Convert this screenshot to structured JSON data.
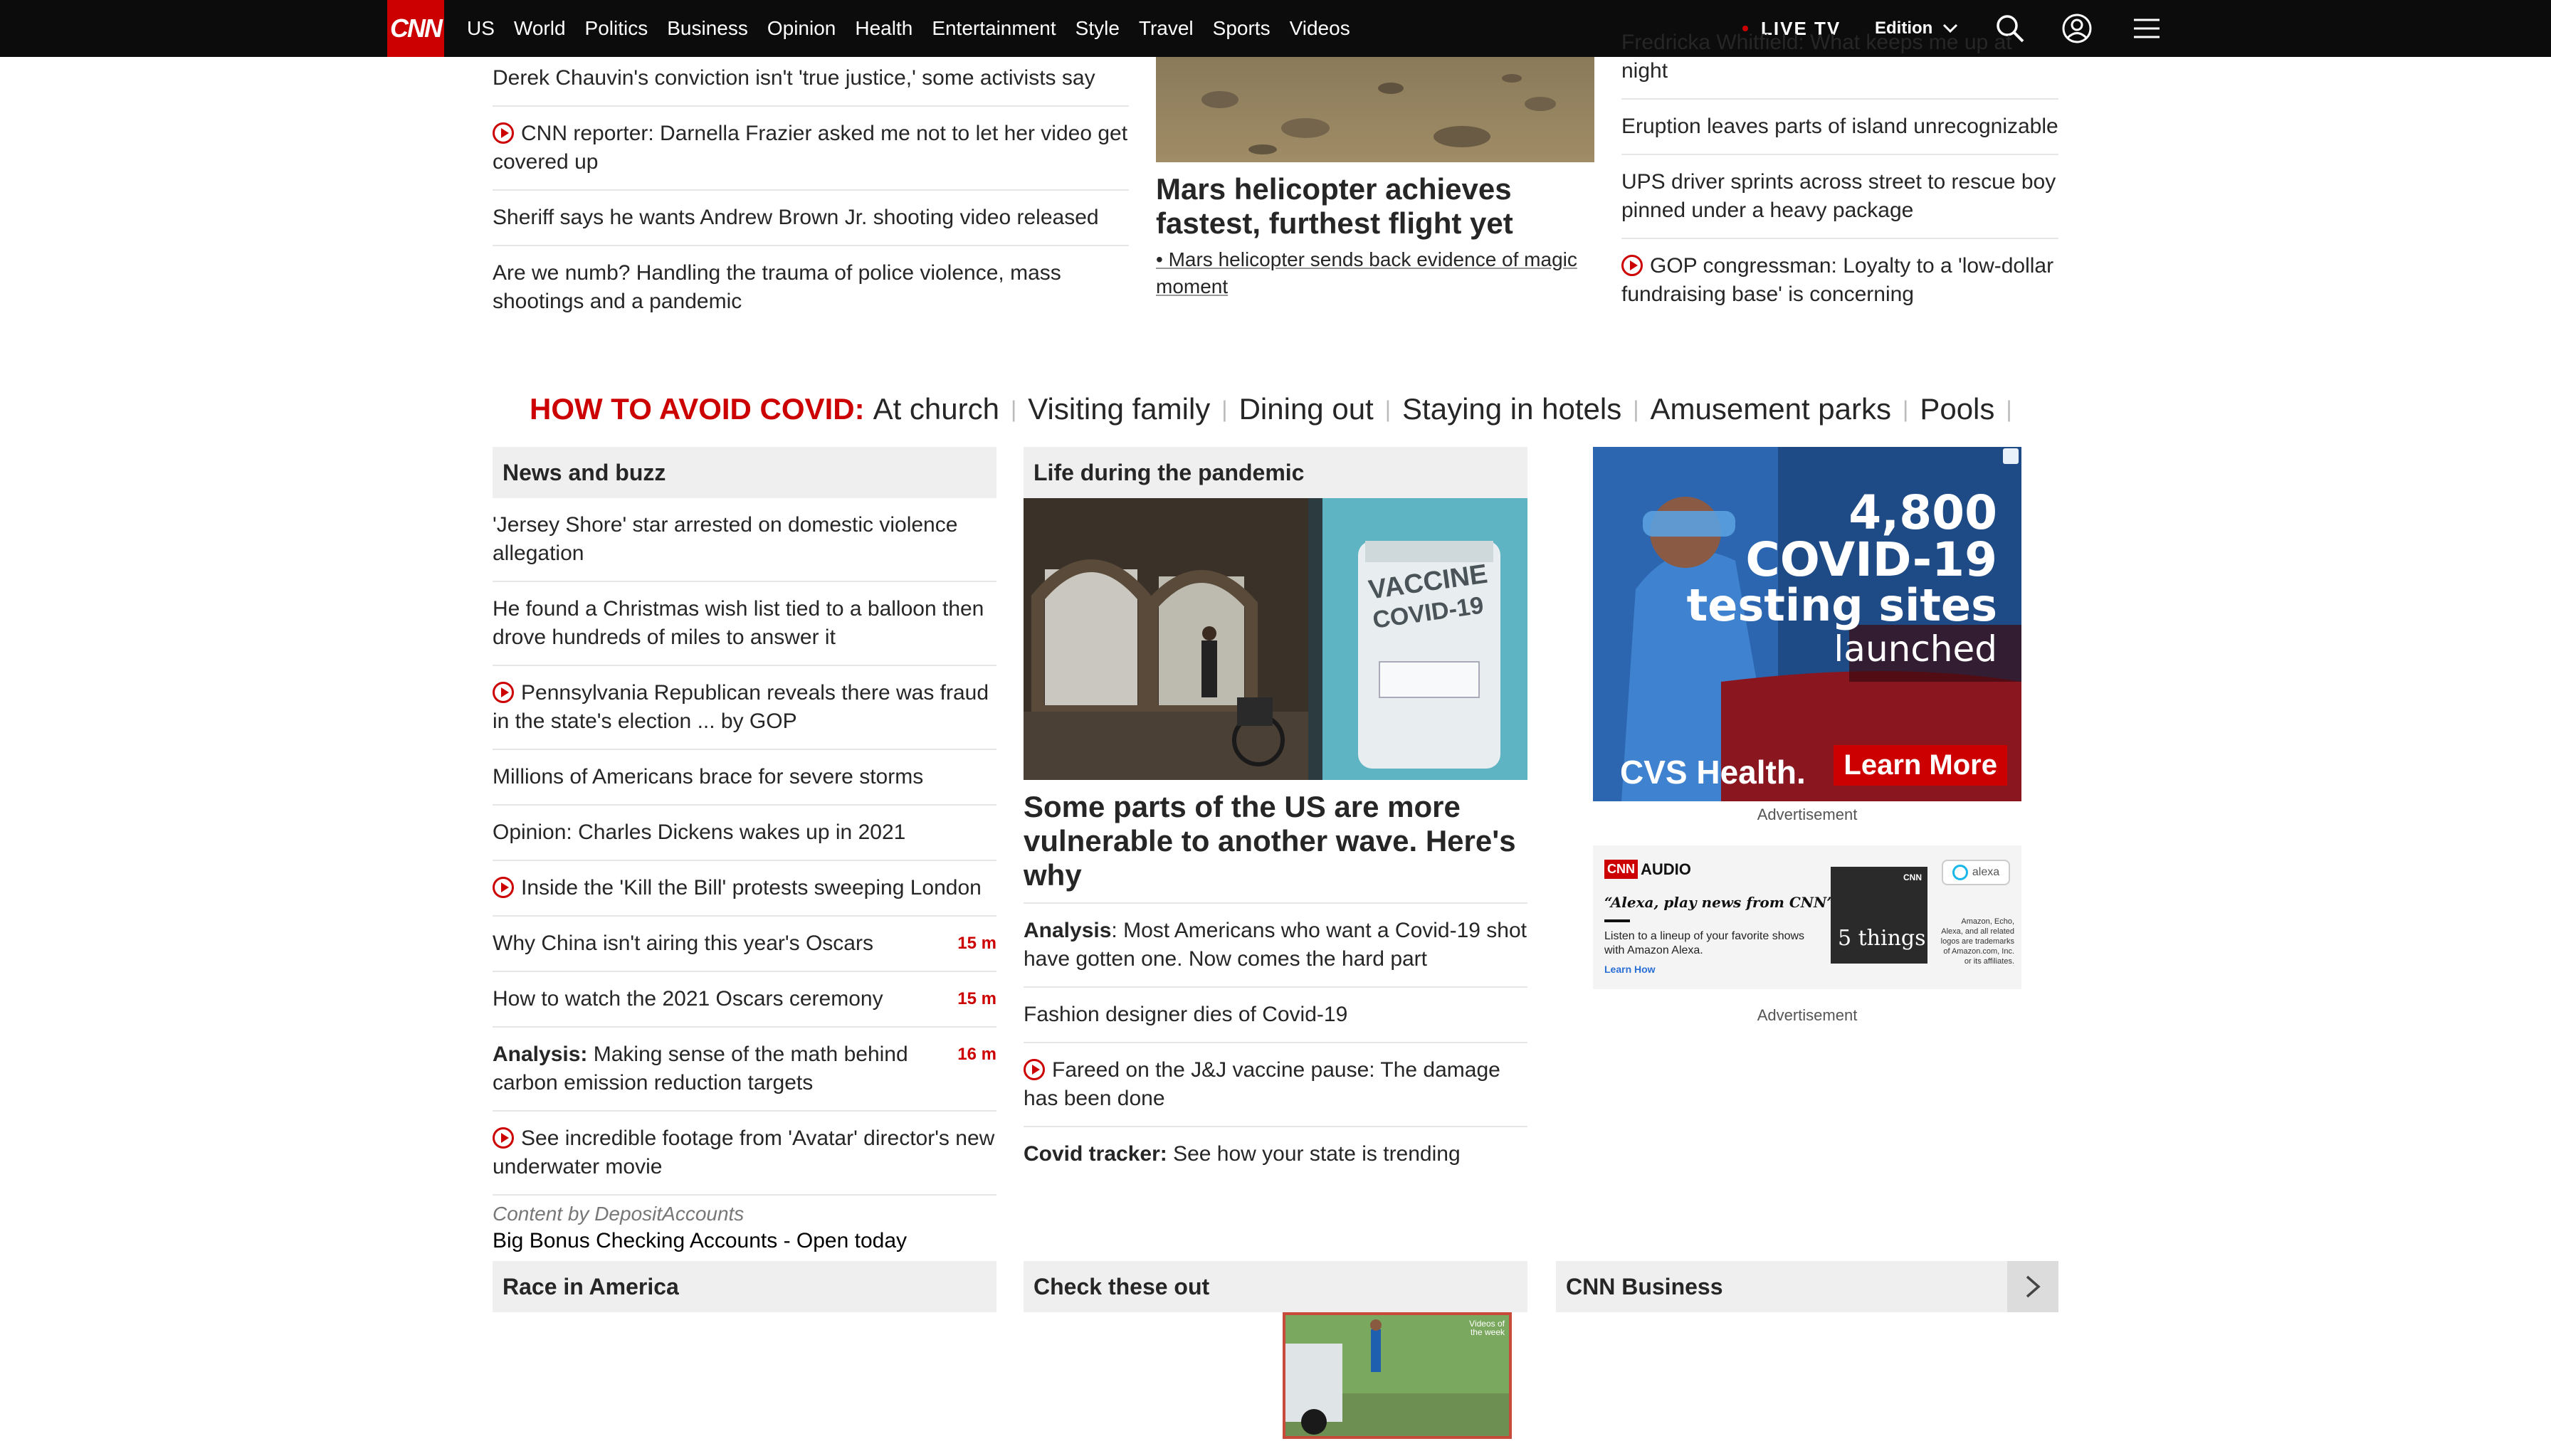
{
  "nav": {
    "logo": "CNN",
    "links": [
      "US",
      "World",
      "Politics",
      "Business",
      "Opinion",
      "Health",
      "Entertainment",
      "Style",
      "Travel",
      "Sports",
      "Videos"
    ],
    "live_tv": "LIVE TV",
    "edition": "Edition"
  },
  "top": {
    "left_items": [
      {
        "text": "Derek Chauvin's conviction isn't 'true justice,' some activists say",
        "video": false
      },
      {
        "text": "CNN reporter: Darnella Frazier asked me not to let her video get covered up",
        "video": true
      },
      {
        "text": "Sheriff says he wants Andrew Brown Jr. shooting video released",
        "video": false
      },
      {
        "text": "Are we numb? Handling the trauma of police violence, mass shootings and a pandemic",
        "video": false
      }
    ],
    "center": {
      "headline": "Mars helicopter achieves fastest, furthest flight yet",
      "sub": "• Mars helicopter sends back evidence of magic moment"
    },
    "right_items": [
      {
        "text": "Fredricka Whitfield: What keeps me up at night",
        "video": false
      },
      {
        "text": "Eruption leaves parts of island unrecognizable",
        "video": false
      },
      {
        "text": "UPS driver sprints across street to rescue boy pinned under a heavy package",
        "video": false
      },
      {
        "text": "GOP congressman: Loyalty to a 'low-dollar fundraising base' is concerning",
        "video": true
      }
    ]
  },
  "covid_bar": {
    "label": "HOW TO AVOID COVID:",
    "links": [
      "At church",
      "Visiting family",
      "Dining out",
      "Staying in hotels",
      "Amusement parks",
      "Pools"
    ]
  },
  "news_buzz": {
    "title": "News and buzz",
    "items": [
      {
        "text": "'Jersey Shore' star arrested on domestic violence allegation",
        "video": false,
        "time": "",
        "prefix": ""
      },
      {
        "text": "He found a Christmas wish list tied to a balloon then drove hundreds of miles to answer it",
        "video": false,
        "time": "",
        "prefix": ""
      },
      {
        "text": "Pennsylvania Republican reveals there was fraud in the state's election ... by GOP",
        "video": true,
        "time": "",
        "prefix": ""
      },
      {
        "text": "Millions of Americans brace for severe storms",
        "video": false,
        "time": "",
        "prefix": ""
      },
      {
        "text": "Opinion: Charles Dickens wakes up in 2021",
        "video": false,
        "time": "",
        "prefix": ""
      },
      {
        "text": "Inside the 'Kill the Bill' protests sweeping London",
        "video": true,
        "time": "",
        "prefix": ""
      },
      {
        "text": "Why China isn't airing this year's Oscars",
        "video": false,
        "time": "15 m",
        "prefix": ""
      },
      {
        "text": "How to watch the 2021 Oscars ceremony",
        "video": false,
        "time": "15 m",
        "prefix": ""
      },
      {
        "text": " Making sense of the math behind carbon emission reduction targets",
        "video": false,
        "time": "16 m",
        "prefix": "Analysis:"
      },
      {
        "text": "See incredible footage from 'Avatar' director's new underwater movie",
        "video": true,
        "time": "",
        "prefix": ""
      }
    ],
    "sponsor_label": "Content by DepositAccounts",
    "sponsor_text": "Big Bonus Checking Accounts - Open today"
  },
  "pandemic": {
    "title": "Life during the pandemic",
    "image_sign_line1": "VACCINE",
    "image_sign_line2": "COVID-19",
    "headline": "Some parts of the US are more vulnerable to another wave. Here's why",
    "items": [
      {
        "prefix": "Analysis",
        "text": ": Most Americans who want a Covid-19 shot have gotten one. Now comes the hard part",
        "video": false
      },
      {
        "prefix": "",
        "text": "Fashion designer dies of Covid-19",
        "video": false
      },
      {
        "prefix": "",
        "text": "Fareed on the J&J vaccine pause: The damage has been done",
        "video": true
      },
      {
        "prefix": "Covid tracker:",
        "text": " See how your state is trending",
        "video": false
      }
    ]
  },
  "ads": {
    "cvs": {
      "line1": "4,800",
      "line2": "COVID-19",
      "line3": "testing sites",
      "line4": "launched",
      "brand": "CVS Health.",
      "cta": "Learn More"
    },
    "label": "Advertisement",
    "audio": {
      "brand": "AUDIO",
      "quote": "“Alexa, play news from CNN”",
      "desc": "Listen to a lineup of your favorite shows with Amazon Alexa.",
      "learn": "Learn How",
      "tile": "5 things",
      "alexa": "alexa",
      "legal": "Amazon, Echo, Alexa, and all related logos are trademarks of Amazon.com, Inc. or its affiliates."
    },
    "label2": "Advertisement"
  },
  "bottom": {
    "race": "Race in America",
    "check": "Check these out",
    "business": "CNN Business",
    "thumb_caption": "Videos of the week"
  }
}
